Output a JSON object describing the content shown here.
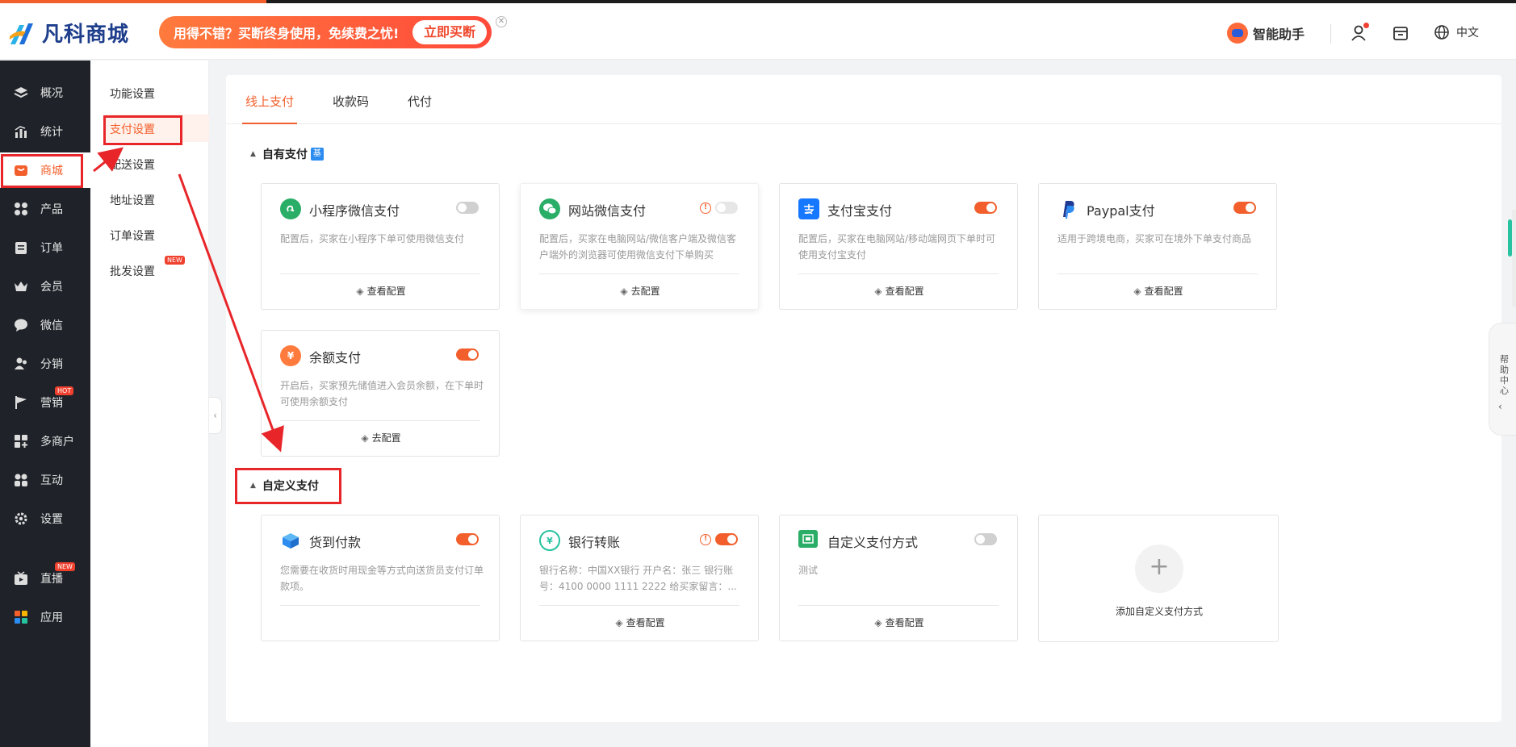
{
  "header": {
    "logo_text": "凡科商城",
    "promo_text": "用得不错？买断终身使用，免续费之忧!",
    "promo_button": "立即买断",
    "promo_close": "✕",
    "assistant_label": "智能助手",
    "language": "中文"
  },
  "sidebar": {
    "items": [
      {
        "label": "概况",
        "icon": "layers-icon"
      },
      {
        "label": "统计",
        "icon": "chart-icon"
      },
      {
        "label": "商城",
        "icon": "store-icon"
      },
      {
        "label": "产品",
        "icon": "grid-icon"
      },
      {
        "label": "订单",
        "icon": "clipboard-icon"
      },
      {
        "label": "会员",
        "icon": "crown-icon"
      },
      {
        "label": "微信",
        "icon": "chat-icon"
      },
      {
        "label": "分销",
        "icon": "users-icon"
      },
      {
        "label": "营销",
        "icon": "flag-icon",
        "badge": "HOT"
      },
      {
        "label": "多商户",
        "icon": "multi-store-icon"
      },
      {
        "label": "互动",
        "icon": "interact-icon"
      },
      {
        "label": "设置",
        "icon": "gear-icon"
      },
      {
        "label": "直播",
        "icon": "live-icon",
        "badge": "NEW"
      },
      {
        "label": "应用",
        "icon": "apps-icon"
      }
    ]
  },
  "subnav": {
    "items": [
      {
        "label": "功能设置"
      },
      {
        "label": "支付设置"
      },
      {
        "label": "配送设置"
      },
      {
        "label": "地址设置"
      },
      {
        "label": "订单设置"
      },
      {
        "label": "批发设置",
        "badge": "NEW"
      }
    ]
  },
  "tabs": [
    {
      "label": "线上支付"
    },
    {
      "label": "收款码"
    },
    {
      "label": "代付"
    }
  ],
  "sections": {
    "own_title": "自有支付",
    "own_tag": "基",
    "custom_title": "自定义支付"
  },
  "own_cards": [
    {
      "title": "小程序微信支付",
      "desc": "配置后，买家在小程序下单可使用微信支付",
      "link": "查看配置",
      "enabled": false
    },
    {
      "title": "网站微信支付",
      "desc": "配置后，买家在电脑网站/微信客户端及微信客户端外的浏览器可使用微信支付下单购买",
      "link": "去配置",
      "enabled": false,
      "warning": "!"
    },
    {
      "title": "支付宝支付",
      "desc": "配置后，买家在电脑网站/移动端网页下单时可使用支付宝支付",
      "link": "查看配置",
      "enabled": true
    },
    {
      "title": "Paypal支付",
      "desc": "适用于跨境电商，买家可在境外下单支付商品",
      "link": "查看配置",
      "enabled": true
    },
    {
      "title": "余额支付",
      "desc": "开启后，买家预先储值进入会员余额，在下单时可使用余额支付",
      "link": "去配置",
      "enabled": true
    }
  ],
  "custom_cards": [
    {
      "title": "货到付款",
      "desc": "您需要在收货时用现金等方式向送货员支付订单款项。",
      "enabled": true
    },
    {
      "title": "银行转账",
      "desc": "银行名称：中国XX银行 开户名：张三 银行账号：4100 0000 1111 2222 给买家留言：...",
      "link": "查看配置",
      "enabled": true,
      "warning": "!"
    },
    {
      "title": "自定义支付方式",
      "desc": "测试",
      "link": "查看配置",
      "enabled": false
    }
  ],
  "add_custom": {
    "label": "添加自定义支付方式",
    "plus": "+"
  },
  "help": {
    "label": "帮助中心",
    "chevron": "‹"
  },
  "collapse": "‹",
  "colors": {
    "accent": "#f25f2c",
    "sidebar_bg": "#1f2329",
    "annotation_red": "#e8262a"
  }
}
